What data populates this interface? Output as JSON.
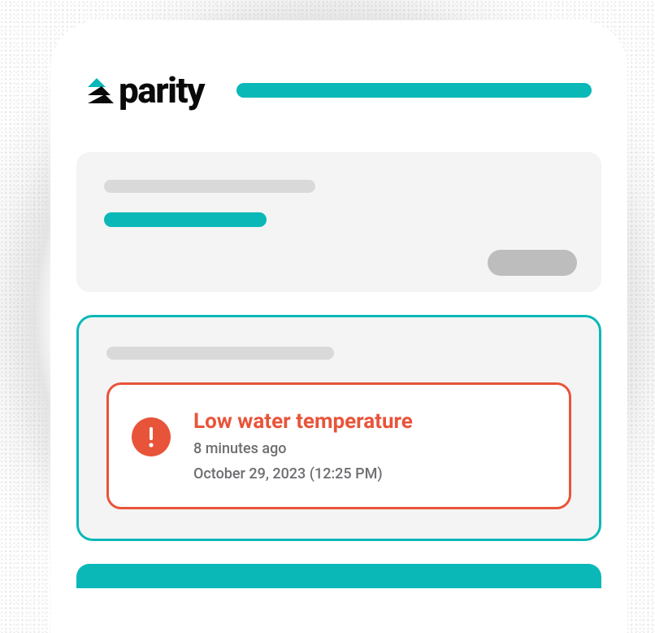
{
  "brand": {
    "name": "parity"
  },
  "alert": {
    "title": "Low water temperature",
    "relative_time": "8 minutes ago",
    "timestamp": "October 29, 2023 (12:25 PM)"
  },
  "colors": {
    "accent_teal": "#0bb8b8",
    "alert_red": "#e8543a",
    "panel_bg": "#f4f4f4",
    "placeholder_grey": "#d9d9d9",
    "pill_grey": "#bdbdbd",
    "text_muted": "#6f6f73"
  }
}
